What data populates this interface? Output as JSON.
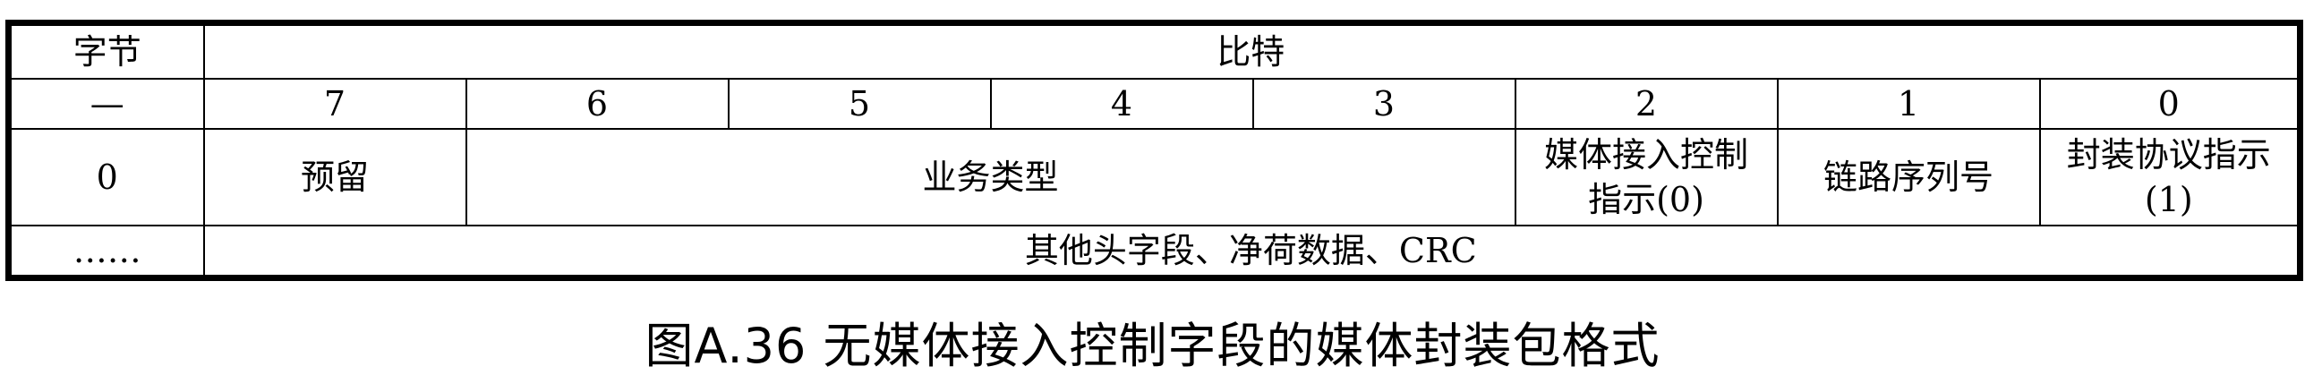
{
  "table": {
    "header": {
      "byte_label": "字节",
      "bit_label": "比特"
    },
    "bit_row": {
      "byte_cell": "—",
      "bits": [
        "7",
        "6",
        "5",
        "4",
        "3",
        "2",
        "1",
        "0"
      ]
    },
    "byte0_row": {
      "byte_cell": "0",
      "reserved": "预留",
      "service_type": "业务类型",
      "media_access_control_indicator": "媒体接入控制指示(0)",
      "link_sequence_number": "链路序列号",
      "encapsulation_protocol_indicator": "封装协议指示(1)"
    },
    "more_row": {
      "byte_cell": "……",
      "content": "其他头字段、净荷数据、CRC"
    }
  },
  "caption": "图A.36 无媒体接入控制字段的媒体封装包格式"
}
